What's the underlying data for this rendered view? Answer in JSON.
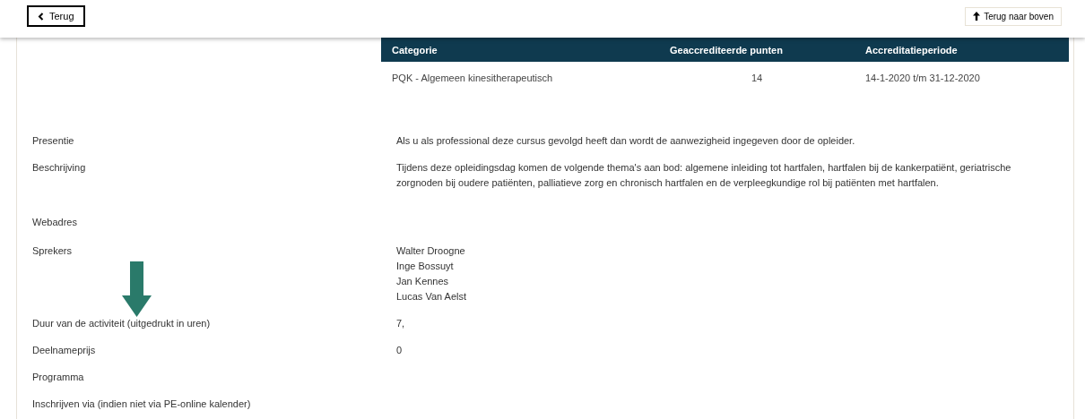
{
  "top_bar": {
    "back_button": {
      "label": "Terug"
    },
    "top_button": {
      "label": "Terug naar boven"
    }
  },
  "points_table": {
    "columns": [
      "Categorie",
      "Geaccrediteerde punten",
      "Accreditatieperiode"
    ],
    "rows": [
      [
        "PQK - Algemeen kinesitherapeutisch",
        "14",
        "14-1-2020 t/m 31-12-2020"
      ]
    ]
  },
  "details": [
    {
      "label": "Presentie",
      "values": [
        "Als u als professional deze cursus gevolgd heeft dan wordt de aanwezigheid ingegeven door de opleider."
      ]
    },
    {
      "label": "Beschrijving",
      "values": [
        "Tijdens deze opleidingsdag komen de volgende thema's aan bod: algemene inleiding tot hartfalen, hartfalen bij de kankerpatiënt, geriatrische zorgnoden bij oudere patiënten, palliatieve zorg en chronisch hartfalen en de verpleegkundige rol bij patiënten met hartfalen."
      ]
    },
    {
      "label": "Webadres"
    },
    {
      "label": "Sprekers",
      "values": [
        "Walter Droogne",
        "Inge Bossuyt",
        "Jan Kennes",
        "Lucas Van Aelst"
      ]
    },
    {
      "label": "Duur van de activiteit (uitgedrukt in uren)",
      "values": [
        "7,"
      ]
    },
    {
      "label": "Deelnameprijs",
      "values": [
        "0"
      ]
    },
    {
      "label": "Programma"
    },
    {
      "label": "Inschrijven via (indien niet via PE-online kalender)"
    }
  ]
}
